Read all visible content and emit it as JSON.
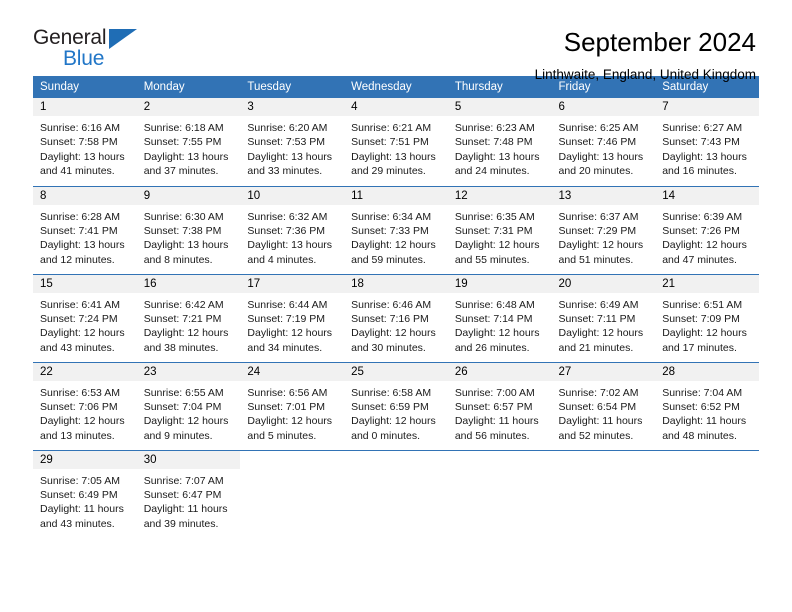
{
  "brand": {
    "name_part1": "General",
    "name_part2": "Blue",
    "triangle_color": "#1f6db5"
  },
  "header": {
    "title": "September 2024",
    "subtitle": "Linthwaite, England, United Kingdom"
  },
  "theme": {
    "header_row_bg": "#3273b5",
    "daynum_bg": "#f1f1f1",
    "grid_line": "#3273b5"
  },
  "weekday_headers": [
    "Sunday",
    "Monday",
    "Tuesday",
    "Wednesday",
    "Thursday",
    "Friday",
    "Saturday"
  ],
  "weeks": [
    [
      {
        "day": "1",
        "sunrise": "Sunrise: 6:16 AM",
        "sunset": "Sunset: 7:58 PM",
        "daylight": "Daylight: 13 hours and 41 minutes."
      },
      {
        "day": "2",
        "sunrise": "Sunrise: 6:18 AM",
        "sunset": "Sunset: 7:55 PM",
        "daylight": "Daylight: 13 hours and 37 minutes."
      },
      {
        "day": "3",
        "sunrise": "Sunrise: 6:20 AM",
        "sunset": "Sunset: 7:53 PM",
        "daylight": "Daylight: 13 hours and 33 minutes."
      },
      {
        "day": "4",
        "sunrise": "Sunrise: 6:21 AM",
        "sunset": "Sunset: 7:51 PM",
        "daylight": "Daylight: 13 hours and 29 minutes."
      },
      {
        "day": "5",
        "sunrise": "Sunrise: 6:23 AM",
        "sunset": "Sunset: 7:48 PM",
        "daylight": "Daylight: 13 hours and 24 minutes."
      },
      {
        "day": "6",
        "sunrise": "Sunrise: 6:25 AM",
        "sunset": "Sunset: 7:46 PM",
        "daylight": "Daylight: 13 hours and 20 minutes."
      },
      {
        "day": "7",
        "sunrise": "Sunrise: 6:27 AM",
        "sunset": "Sunset: 7:43 PM",
        "daylight": "Daylight: 13 hours and 16 minutes."
      }
    ],
    [
      {
        "day": "8",
        "sunrise": "Sunrise: 6:28 AM",
        "sunset": "Sunset: 7:41 PM",
        "daylight": "Daylight: 13 hours and 12 minutes."
      },
      {
        "day": "9",
        "sunrise": "Sunrise: 6:30 AM",
        "sunset": "Sunset: 7:38 PM",
        "daylight": "Daylight: 13 hours and 8 minutes."
      },
      {
        "day": "10",
        "sunrise": "Sunrise: 6:32 AM",
        "sunset": "Sunset: 7:36 PM",
        "daylight": "Daylight: 13 hours and 4 minutes."
      },
      {
        "day": "11",
        "sunrise": "Sunrise: 6:34 AM",
        "sunset": "Sunset: 7:33 PM",
        "daylight": "Daylight: 12 hours and 59 minutes."
      },
      {
        "day": "12",
        "sunrise": "Sunrise: 6:35 AM",
        "sunset": "Sunset: 7:31 PM",
        "daylight": "Daylight: 12 hours and 55 minutes."
      },
      {
        "day": "13",
        "sunrise": "Sunrise: 6:37 AM",
        "sunset": "Sunset: 7:29 PM",
        "daylight": "Daylight: 12 hours and 51 minutes."
      },
      {
        "day": "14",
        "sunrise": "Sunrise: 6:39 AM",
        "sunset": "Sunset: 7:26 PM",
        "daylight": "Daylight: 12 hours and 47 minutes."
      }
    ],
    [
      {
        "day": "15",
        "sunrise": "Sunrise: 6:41 AM",
        "sunset": "Sunset: 7:24 PM",
        "daylight": "Daylight: 12 hours and 43 minutes."
      },
      {
        "day": "16",
        "sunrise": "Sunrise: 6:42 AM",
        "sunset": "Sunset: 7:21 PM",
        "daylight": "Daylight: 12 hours and 38 minutes."
      },
      {
        "day": "17",
        "sunrise": "Sunrise: 6:44 AM",
        "sunset": "Sunset: 7:19 PM",
        "daylight": "Daylight: 12 hours and 34 minutes."
      },
      {
        "day": "18",
        "sunrise": "Sunrise: 6:46 AM",
        "sunset": "Sunset: 7:16 PM",
        "daylight": "Daylight: 12 hours and 30 minutes."
      },
      {
        "day": "19",
        "sunrise": "Sunrise: 6:48 AM",
        "sunset": "Sunset: 7:14 PM",
        "daylight": "Daylight: 12 hours and 26 minutes."
      },
      {
        "day": "20",
        "sunrise": "Sunrise: 6:49 AM",
        "sunset": "Sunset: 7:11 PM",
        "daylight": "Daylight: 12 hours and 21 minutes."
      },
      {
        "day": "21",
        "sunrise": "Sunrise: 6:51 AM",
        "sunset": "Sunset: 7:09 PM",
        "daylight": "Daylight: 12 hours and 17 minutes."
      }
    ],
    [
      {
        "day": "22",
        "sunrise": "Sunrise: 6:53 AM",
        "sunset": "Sunset: 7:06 PM",
        "daylight": "Daylight: 12 hours and 13 minutes."
      },
      {
        "day": "23",
        "sunrise": "Sunrise: 6:55 AM",
        "sunset": "Sunset: 7:04 PM",
        "daylight": "Daylight: 12 hours and 9 minutes."
      },
      {
        "day": "24",
        "sunrise": "Sunrise: 6:56 AM",
        "sunset": "Sunset: 7:01 PM",
        "daylight": "Daylight: 12 hours and 5 minutes."
      },
      {
        "day": "25",
        "sunrise": "Sunrise: 6:58 AM",
        "sunset": "Sunset: 6:59 PM",
        "daylight": "Daylight: 12 hours and 0 minutes."
      },
      {
        "day": "26",
        "sunrise": "Sunrise: 7:00 AM",
        "sunset": "Sunset: 6:57 PM",
        "daylight": "Daylight: 11 hours and 56 minutes."
      },
      {
        "day": "27",
        "sunrise": "Sunrise: 7:02 AM",
        "sunset": "Sunset: 6:54 PM",
        "daylight": "Daylight: 11 hours and 52 minutes."
      },
      {
        "day": "28",
        "sunrise": "Sunrise: 7:04 AM",
        "sunset": "Sunset: 6:52 PM",
        "daylight": "Daylight: 11 hours and 48 minutes."
      }
    ],
    [
      {
        "day": "29",
        "sunrise": "Sunrise: 7:05 AM",
        "sunset": "Sunset: 6:49 PM",
        "daylight": "Daylight: 11 hours and 43 minutes."
      },
      {
        "day": "30",
        "sunrise": "Sunrise: 7:07 AM",
        "sunset": "Sunset: 6:47 PM",
        "daylight": "Daylight: 11 hours and 39 minutes."
      },
      {
        "day": "",
        "sunrise": "",
        "sunset": "",
        "daylight": ""
      },
      {
        "day": "",
        "sunrise": "",
        "sunset": "",
        "daylight": ""
      },
      {
        "day": "",
        "sunrise": "",
        "sunset": "",
        "daylight": ""
      },
      {
        "day": "",
        "sunrise": "",
        "sunset": "",
        "daylight": ""
      },
      {
        "day": "",
        "sunrise": "",
        "sunset": "",
        "daylight": ""
      }
    ]
  ]
}
